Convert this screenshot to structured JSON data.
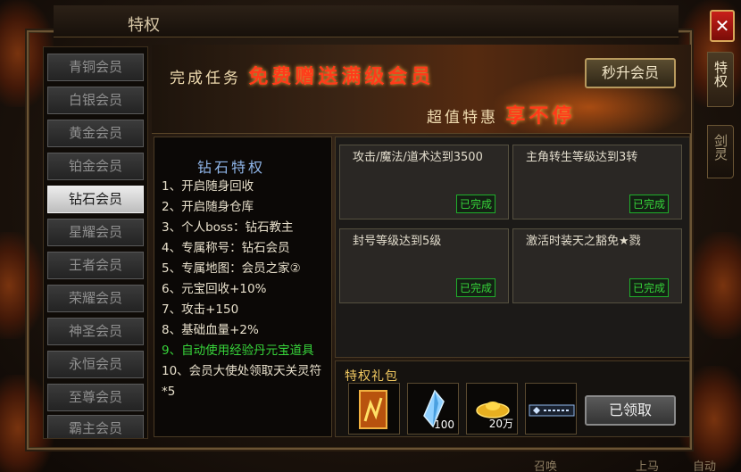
{
  "window": {
    "title": "特权",
    "close_label": "✕"
  },
  "side_tabs": [
    {
      "label": "特权",
      "active": true
    },
    {
      "label": "剑灵",
      "active": false
    }
  ],
  "sidebar": {
    "items": [
      {
        "label": "青铜会员"
      },
      {
        "label": "白银会员"
      },
      {
        "label": "黄金会员"
      },
      {
        "label": "铂金会员"
      },
      {
        "label": "钻石会员",
        "active": true
      },
      {
        "label": "星耀会员"
      },
      {
        "label": "王者会员"
      },
      {
        "label": "荣耀会员"
      },
      {
        "label": "神圣会员"
      },
      {
        "label": "永恒会员"
      },
      {
        "label": "至尊会员"
      },
      {
        "label": "霸主会员"
      }
    ]
  },
  "banner": {
    "line1_prefix": "完成任务",
    "line1_highlight": "免费赠送满级会员",
    "line2_prefix": "超值特惠",
    "line2_highlight": "享不停",
    "upgrade_button": "秒升会员"
  },
  "privileges": {
    "title": "钻石特权",
    "items": [
      {
        "text": "1、开启随身回收"
      },
      {
        "text": "2、开启随身仓库"
      },
      {
        "text": "3、个人boss：钻石教主"
      },
      {
        "text": "4、专属称号：钻石会员"
      },
      {
        "text": "5、专属地图：会员之家②"
      },
      {
        "text": "6、元宝回收+10%"
      },
      {
        "text": "7、攻击+150"
      },
      {
        "text": "8、基础血量+2%"
      },
      {
        "text": "9、自动使用经验丹元宝道具",
        "highlight": true
      },
      {
        "text": "10、会员大使处领取天关灵符*5"
      }
    ]
  },
  "tasks": [
    {
      "text": "攻击/魔法/道术达到3500",
      "status": "已完成"
    },
    {
      "text": "主角转生等级达到3转",
      "status": "已完成"
    },
    {
      "text": "封号等级达到5级",
      "status": "已完成"
    },
    {
      "text": "激活时装天之豁免★戮",
      "status": "已完成"
    }
  ],
  "gift": {
    "title": "特权礼包",
    "items": [
      {
        "icon": "fire-scroll-icon",
        "qty": ""
      },
      {
        "icon": "crystal-icon",
        "qty": "100"
      },
      {
        "icon": "gold-ingot-icon",
        "qty": "20万"
      },
      {
        "icon": "diamond-member-title-icon",
        "qty": ""
      }
    ],
    "claim_button": "已领取"
  },
  "footer": {
    "items": [
      "召唤",
      "上马",
      "自动"
    ]
  },
  "colors": {
    "accent_gold": "#f0c860",
    "banner_red": "#ff3b1a",
    "status_green": "#37d43a",
    "privilege_title_blue": "#8fb5e8"
  }
}
